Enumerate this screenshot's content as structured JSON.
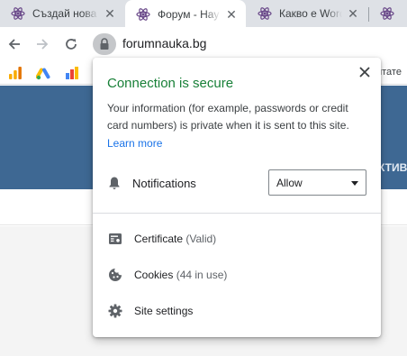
{
  "tabs": [
    {
      "title": "Създай нова т",
      "close": "✕"
    },
    {
      "title": "Форум - Нау",
      "close": "✕"
    },
    {
      "title": "Какво е Word",
      "close": "✕"
    },
    {
      "title": "",
      "close": ""
    }
  ],
  "address_bar": {
    "url": "forumnauka.bg"
  },
  "bookmarks_bar": {
    "overflow_text": "итате"
  },
  "page": {
    "banner_text": "КТИВ"
  },
  "site_info_popup": {
    "title": "Connection is secure",
    "description": "Your information (for example, passwords or credit card numbers) is private when it is sent to this site.",
    "learn_more": "Learn more",
    "notifications": {
      "label": "Notifications",
      "value": "Allow"
    },
    "certificate": {
      "label": "Certificate",
      "status": "(Valid)"
    },
    "cookies": {
      "label": "Cookies",
      "status": "(44 in use)"
    },
    "site_settings": {
      "label": "Site settings"
    }
  },
  "colors": {
    "secure_green": "#188038",
    "link_blue": "#1a73e8",
    "banner_blue": "#3e6893",
    "tabstrip_gray": "#dee1e6"
  },
  "icons": {
    "tab_favicon": "atom-icon",
    "back": "back-arrow-icon",
    "forward": "forward-arrow-icon",
    "reload": "reload-icon",
    "lock": "lock-icon",
    "close": "close-icon",
    "notifications": "bell-icon",
    "certificate": "certificate-icon",
    "cookies": "cookie-icon",
    "site_settings": "gear-icon"
  }
}
